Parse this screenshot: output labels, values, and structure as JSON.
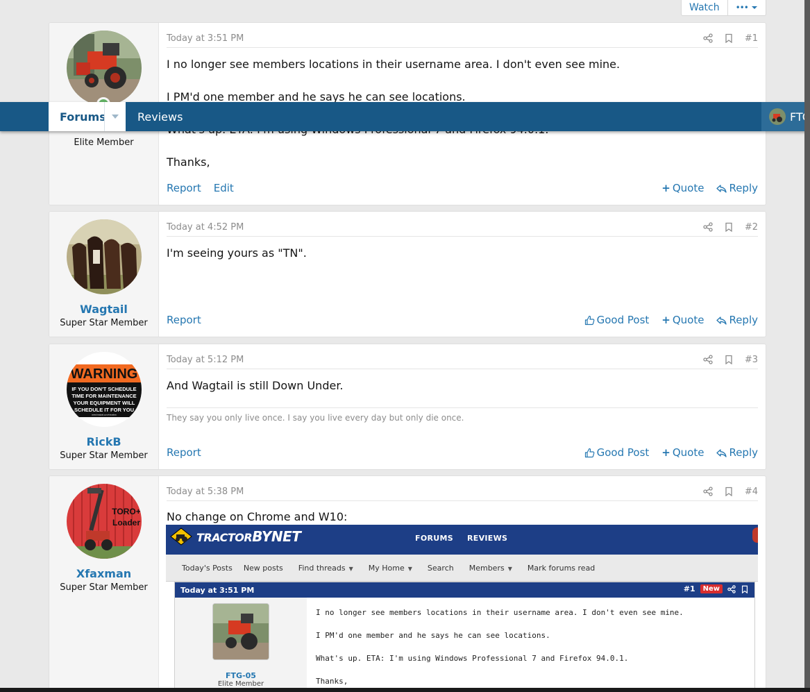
{
  "top_actions": {
    "watch": "Watch",
    "more": "•••"
  },
  "nav": {
    "forums": "Forums",
    "reviews": "Reviews",
    "user_short": "FTC"
  },
  "posts": [
    {
      "username": "",
      "user_title": "Elite Member",
      "time": "Today at 3:51 PM",
      "num": "#1",
      "lines": [
        "I no longer see members locations in their username area. I don't even see mine.",
        "I PM'd one member and he says he can see locations.",
        "What's up. ETA: I'm using Windows Professional 7 and Firefox 94.0.1.",
        "Thanks,"
      ],
      "actions_left": [
        "Report",
        "Edit"
      ],
      "quote": "Quote",
      "reply": "Reply"
    },
    {
      "username": "Wagtail",
      "user_title": "Super Star Member",
      "time": "Today at 4:52 PM",
      "num": "#2",
      "lines": [
        "I'm seeing yours as \"TN\"."
      ],
      "actions_left": [
        "Report"
      ],
      "good": "Good Post",
      "quote": "Quote",
      "reply": "Reply"
    },
    {
      "username": "RickB",
      "user_title": "Super Star Member",
      "time": "Today at 5:12 PM",
      "num": "#3",
      "lines": [
        "And Wagtail is still Down Under."
      ],
      "signature": "They say you only live once. I say you live every day but only die once.",
      "actions_left": [
        "Report"
      ],
      "good": "Good Post",
      "quote": "Quote",
      "reply": "Reply"
    },
    {
      "username": "Xfaxman",
      "user_title": "Super Star Member",
      "time": "Today at 5:38 PM",
      "num": "#4",
      "lines": [
        "No change on Chrome and W10:"
      ]
    }
  ],
  "avatars": {
    "warning_title": "WARNING",
    "warning_lines": [
      "IF YOU DON'T SCHEDULE",
      "TIME FOR MAINTENANCE",
      "YOUR EQUIPMENT WILL",
      "SCHEDULE IT FOR YOU"
    ],
    "warning_url": "www.bradyid.com/visualwo",
    "toro_lines": [
      "TORO+",
      "Loader"
    ]
  },
  "screenshot": {
    "logo_tractor": "TRACTOR",
    "logo_bynet": "BYNET",
    "nav_forums": "FORUMS",
    "nav_reviews": "REVIEWS",
    "subnav": [
      "Today's Posts",
      "New posts",
      "Find threads",
      "My Home",
      "Search",
      "Members",
      "Mark forums read"
    ],
    "bar_time": "Today at 3:51 PM",
    "bar_num": "#1",
    "bar_new": "New",
    "username": "FTG-05",
    "user_title": "Elite Member",
    "lines": [
      "I no longer see members locations in their username area. I don't even see mine.",
      "I PM'd one member and he says he can see locations.",
      "What's up. ETA: I'm using Windows Professional 7 and Firefox 94.0.1.",
      "Thanks,"
    ]
  },
  "colors": {
    "link": "#2577b1",
    "nav": "#185886",
    "online": "#63b265"
  }
}
